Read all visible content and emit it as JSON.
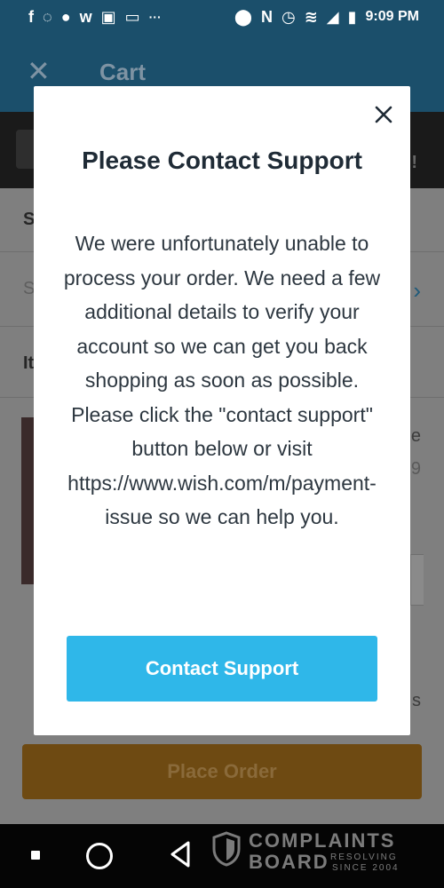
{
  "status_bar": {
    "time": "9:09 PM",
    "left_icons": [
      "facebook-icon",
      "whatsapp-icon",
      "line-icon",
      "wattpad-icon",
      "photo-icon",
      "voicemail-icon",
      "more-dots-icon"
    ],
    "right_icons": [
      "location-icon",
      "nfc-icon",
      "alarm-icon",
      "wifi-icon",
      "signal-icon",
      "battery-icon"
    ]
  },
  "header": {
    "title": "Cart"
  },
  "background": {
    "section_letter_1": "S",
    "section_letter_2": "S",
    "section_letter_3": "It",
    "fragment_1": "e",
    "fragment_2": "9",
    "fragment_3": "s",
    "promo_exclamation": "!"
  },
  "place_order": {
    "label": "Place Order"
  },
  "modal": {
    "title": "Please Contact Support",
    "body": "We were unfortunately unable to process your order. We need a few additional details to verify your account so we can get you back shopping as soon as possible. Please click the \"contact support\" button below or visit https://www.wish.com/m/payment-issue so we can help you.",
    "button_label": "Contact Support"
  },
  "watermark": {
    "line1": "COMPLAINTS",
    "line2": "BOARD",
    "tagline1": "RESOLVING",
    "tagline2": "SINCE 2004"
  },
  "colors": {
    "header": "#1b4f6b",
    "button": "#2fb7e9",
    "place_order": "#6e4a12",
    "title_text": "#1f2b36"
  }
}
